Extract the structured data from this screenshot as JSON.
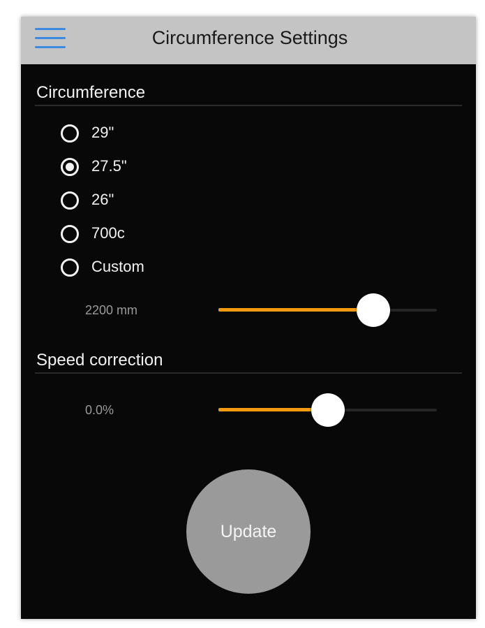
{
  "header": {
    "title": "Circumference Settings",
    "menu_icon": "hamburger-menu-icon"
  },
  "circumference": {
    "heading": "Circumference",
    "options": [
      {
        "label": "29\"",
        "checked": false
      },
      {
        "label": "27.5\"",
        "checked": true
      },
      {
        "label": "26\"",
        "checked": false
      },
      {
        "label": "700c",
        "checked": false
      },
      {
        "label": "Custom",
        "checked": false
      }
    ],
    "value_label": "2200 mm",
    "slider_fraction": 0.71
  },
  "speed_correction": {
    "heading": "Speed correction",
    "value_label": "0.0%",
    "slider_fraction": 0.5
  },
  "update_button": {
    "label": "Update"
  },
  "colors": {
    "background": "#080808",
    "header": "#c4c4c4",
    "menu_icon": "#3d8be0",
    "slider_fill": "#f49b12",
    "button": "#9a9a9a"
  }
}
